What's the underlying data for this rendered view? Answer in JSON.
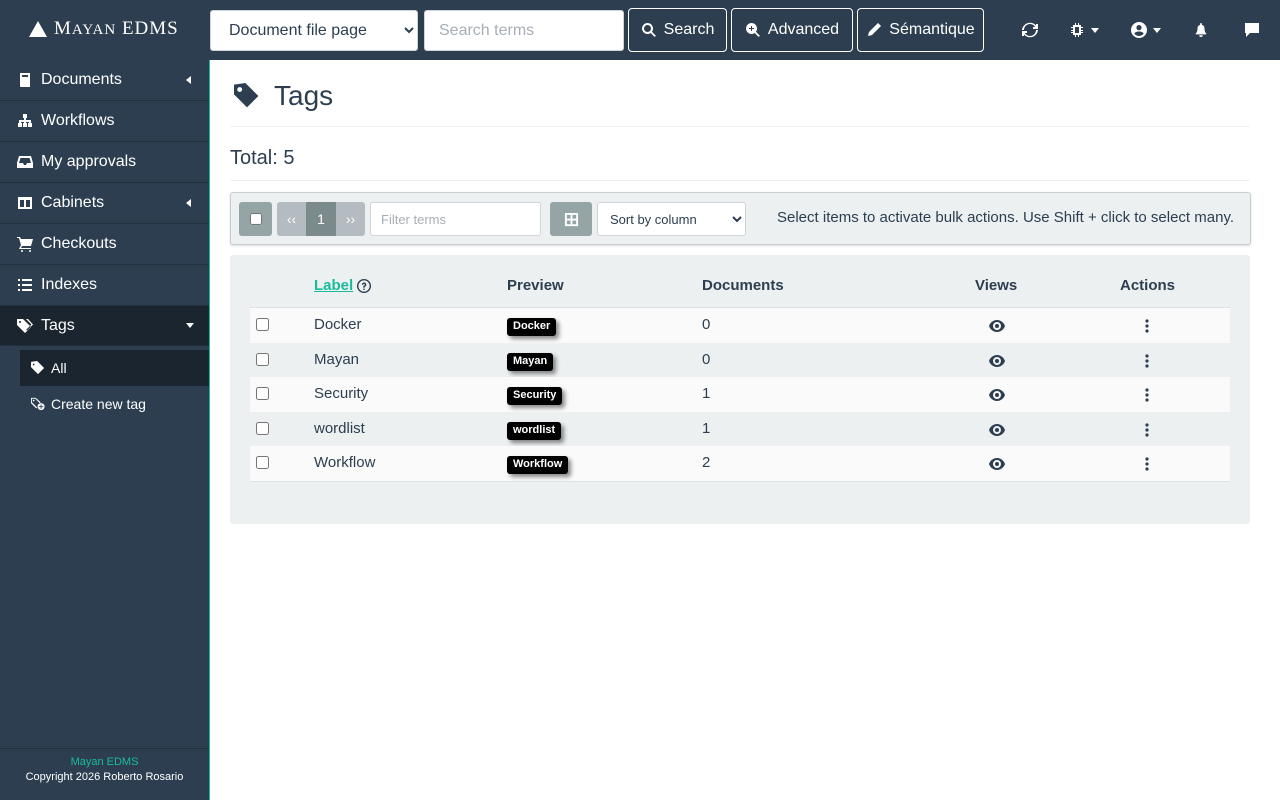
{
  "brand": {
    "name_first": "M",
    "name_rest": "AYAN",
    "name_second": "EDMS"
  },
  "topbar": {
    "search_model": "Document file page",
    "search_placeholder": "Search terms",
    "search_label": "Search",
    "advanced_label": "Advanced",
    "semantic_label": "Sémantique"
  },
  "sidebar": {
    "items": [
      {
        "label": "Documents"
      },
      {
        "label": "Workflows"
      },
      {
        "label": "My approvals"
      },
      {
        "label": "Cabinets"
      },
      {
        "label": "Checkouts"
      },
      {
        "label": "Indexes"
      },
      {
        "label": "Tags"
      }
    ],
    "sub_items": [
      {
        "label": "All"
      },
      {
        "label": "Create new tag"
      }
    ],
    "footer_app": "Mayan EDMS",
    "footer_copyright": "Copyright 2026 Roberto Rosario"
  },
  "page": {
    "title": "Tags",
    "total": "Total: 5"
  },
  "toolbar": {
    "prev": "‹‹",
    "page": "1",
    "next": "››",
    "filter_placeholder": "Filter terms",
    "sort_label": "Sort by column",
    "hint": "Select items to activate bulk actions. Use Shift + click to select many."
  },
  "table": {
    "headers": {
      "label": "Label",
      "preview": "Preview",
      "documents": "Documents",
      "views": "Views",
      "actions": "Actions"
    },
    "rows": [
      {
        "label": "Docker",
        "preview": "Docker",
        "documents": "0",
        "color": "#000000"
      },
      {
        "label": "Mayan",
        "preview": "Mayan",
        "documents": "0",
        "color": "#000000"
      },
      {
        "label": "Security",
        "preview": "Security",
        "documents": "1",
        "color": "#000000"
      },
      {
        "label": "wordlist",
        "preview": "wordlist",
        "documents": "1",
        "color": "#000000"
      },
      {
        "label": "Workflow",
        "preview": "Workflow",
        "documents": "2",
        "color": "#000000"
      }
    ]
  },
  "colors": {
    "navbar": "#2c3e50",
    "accent": "#18bc9c",
    "active_nav": "#1a252f",
    "panel": "#ecf0f1"
  }
}
